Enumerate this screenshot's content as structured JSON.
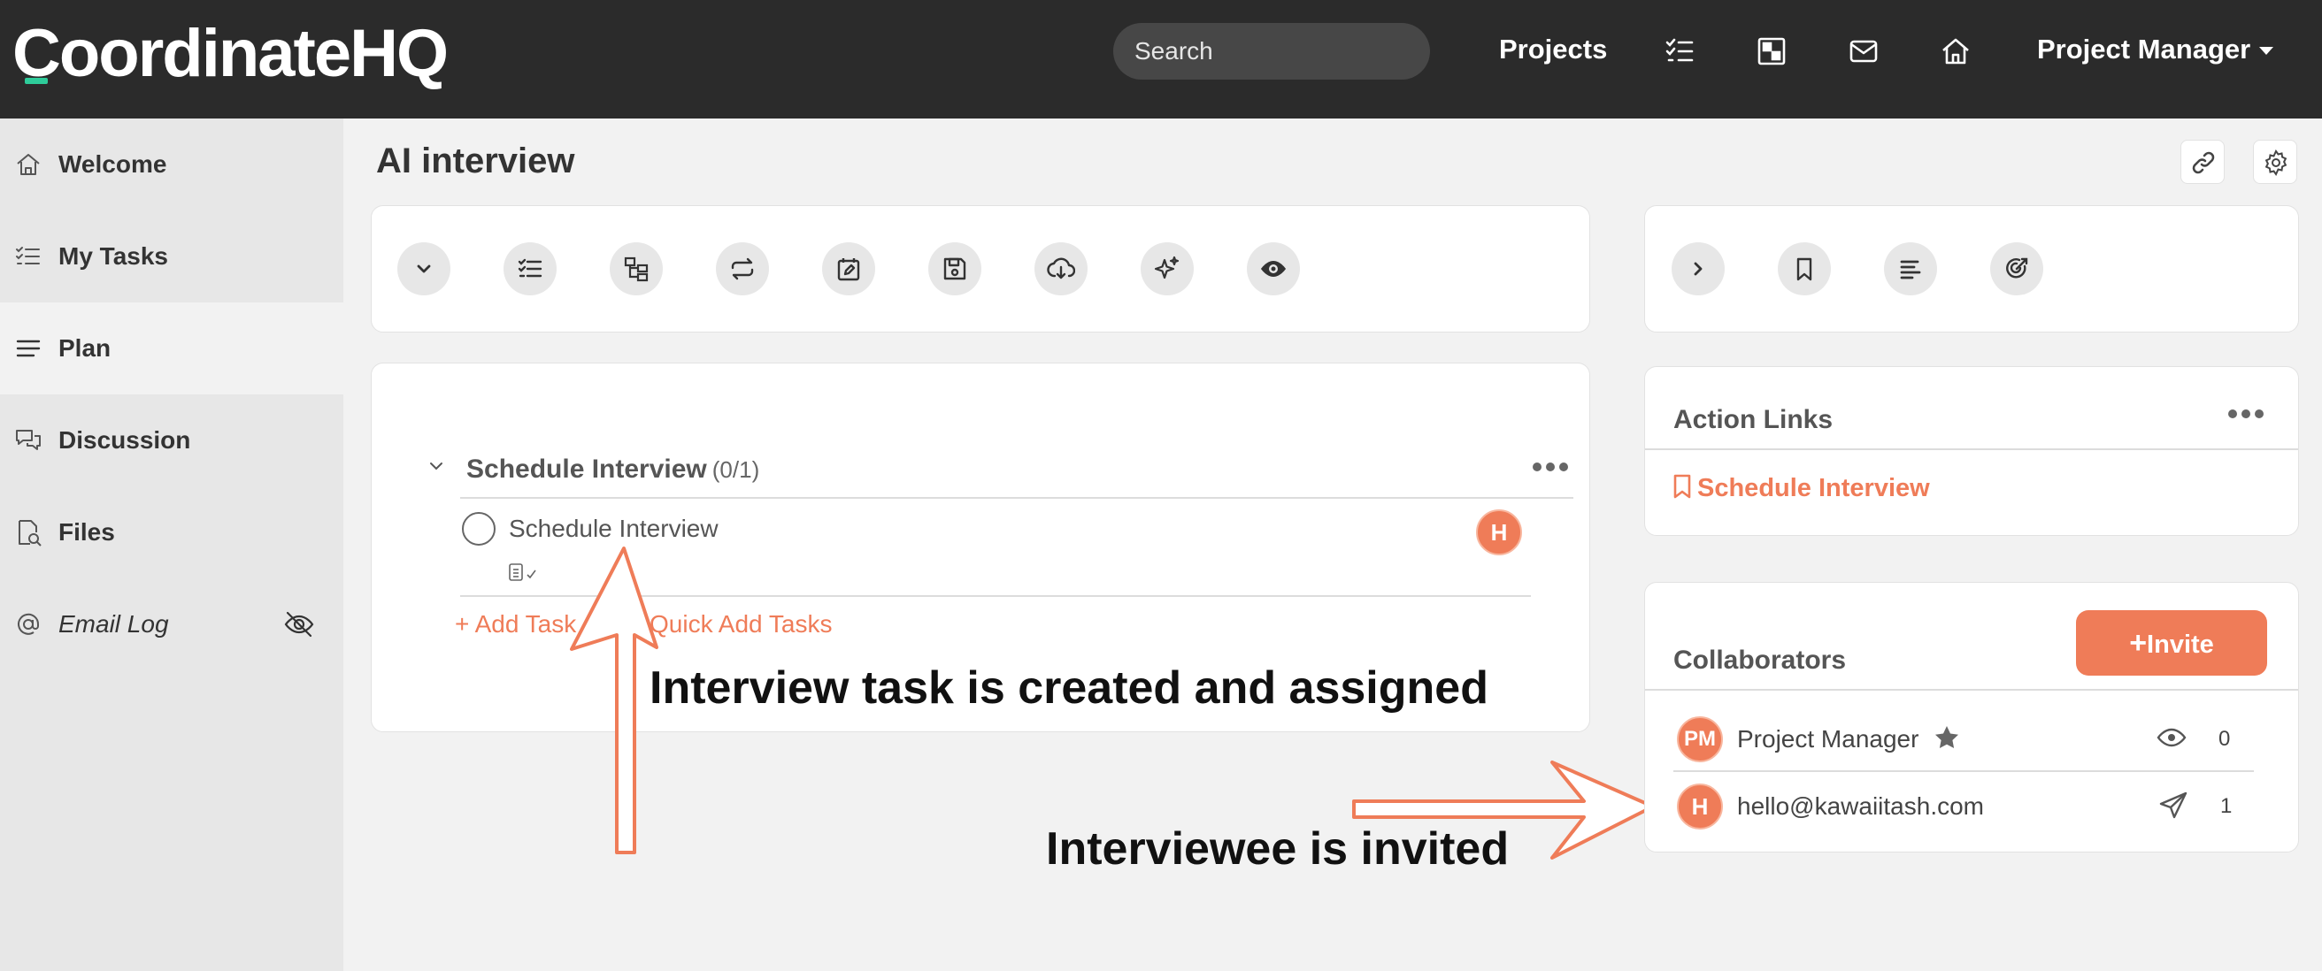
{
  "header": {
    "logo": "CoordinateHQ",
    "search_placeholder": "Search",
    "projects_label": "Projects",
    "icons": [
      "tasks-icon",
      "board-icon",
      "mail-icon",
      "home-icon"
    ],
    "user_menu_label": "Project Manager"
  },
  "sidebar": {
    "items": [
      {
        "label": "Welcome",
        "icon": "home-icon"
      },
      {
        "label": "My Tasks",
        "icon": "tasks-icon"
      },
      {
        "label": "Plan",
        "icon": "menu-icon",
        "active": true
      },
      {
        "label": "Discussion",
        "icon": "chat-icon"
      },
      {
        "label": "Files",
        "icon": "file-search-icon"
      },
      {
        "label": "Email Log",
        "icon": "at-icon",
        "hidden_icon": "eye-off-icon"
      }
    ]
  },
  "main": {
    "title": "AI interview",
    "top_actions": [
      "link-icon",
      "settings-icon"
    ],
    "toolbar_icons": [
      "chevron-down-icon",
      "task-list-icon",
      "hierarchy-icon",
      "repeat-icon",
      "calendar-edit-icon",
      "save-icon",
      "cloud-download-icon",
      "sparkles-icon",
      "eye-icon"
    ],
    "group": {
      "title": "Schedule Interview",
      "count": "(0/1)",
      "tasks": [
        {
          "title": "Schedule Interview",
          "assignee_initial": "H"
        }
      ],
      "add_task_label": "+ Add Task",
      "quick_add_label": "Quick Add Tasks"
    }
  },
  "right": {
    "toolbar_icons": [
      "chevron-right-icon",
      "bookmark-icon",
      "align-left-icon",
      "target-icon"
    ],
    "action_links": {
      "title": "Action Links",
      "links": [
        "Schedule Interview"
      ]
    },
    "collaborators": {
      "title": "Collaborators",
      "invite_label": "Invite",
      "people": [
        {
          "initials": "PM",
          "name": "Project Manager",
          "status_icon": "eye-icon",
          "count": "0",
          "starred": true
        },
        {
          "initials": "H",
          "name": "hello@kawaiitash.com",
          "status_icon": "send-icon",
          "count": "1",
          "starred": false
        }
      ]
    }
  },
  "annotations": {
    "task_note": "Interview task is created and assigned",
    "invite_note": "Interviewee is invited"
  },
  "colors": {
    "accent": "#ef7c58",
    "topbar": "#2b2b2b",
    "logo_mark": "#2ecc9a"
  }
}
